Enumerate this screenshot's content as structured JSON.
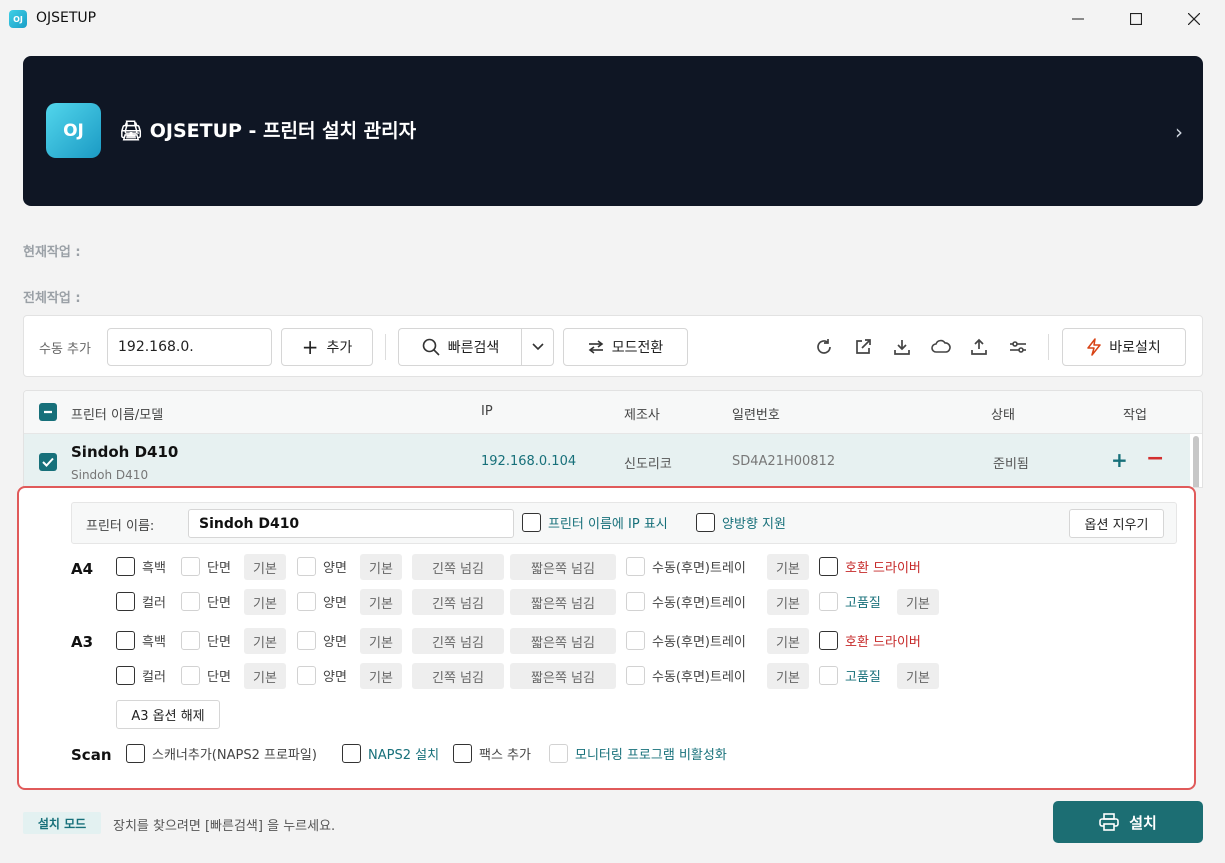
{
  "window": {
    "title": "OJSETUP",
    "app_icon_text": "OJ"
  },
  "banner": {
    "logo_text": "OJ",
    "title": "🖨 OJSETUP - 프린터 설치 관리자"
  },
  "status": {
    "current_label": "현재작업 :",
    "total_label": "전체작업 :"
  },
  "toolbar": {
    "manual_add_label": "수동 추가",
    "ip_value": "192.168.0.",
    "add_label": "추가",
    "quick_search_label": "빠른검색",
    "mode_switch_label": "모드전환",
    "quick_install_label": "바로설치"
  },
  "table": {
    "headers": {
      "name": "프린터 이름/모델",
      "ip": "IP",
      "maker": "제조사",
      "serial": "일련번호",
      "status": "상태",
      "action": "작업"
    },
    "rows": [
      {
        "name": "Sindoh D410",
        "model": "Sindoh D410",
        "ip": "192.168.0.104",
        "maker": "신도리코",
        "serial": "SD4A21H00812",
        "status": "준비됨"
      }
    ]
  },
  "options": {
    "printer_name_label": "프린터 이름:",
    "printer_name_value": "Sindoh D410",
    "show_ip_label": "프린터 이름에 IP 표시",
    "duplex_support_label": "양방향 지원",
    "clear_label": "옵션 지우기",
    "a4_label": "A4",
    "a3_label": "A3",
    "scan_label": "Scan",
    "mono": "흑백",
    "color": "컬러",
    "simplex": "단면",
    "duplex": "양면",
    "default": "기본",
    "long_edge": "긴쪽 넘김",
    "short_edge": "짧은쪽 넘김",
    "manual_tray": "수동(후면)트레이",
    "compat_driver": "호환 드라이버",
    "high_quality": "고품질",
    "a3_release": "A3 옵션 해제",
    "scanner_add": "스캐너추가(NAPS2 프로파일)",
    "naps2_install": "NAPS2 설치",
    "fax_add": "팩스 추가",
    "monitor_disable": "모니터링 프로그램 비활성화"
  },
  "footer": {
    "mode_badge": "설치 모드",
    "hint": "장치를 찾으려면 [빠른검색] 을 누르세요.",
    "install_label": "설치"
  },
  "colors": {
    "accent": "#17707a",
    "banner_bg": "#0f1624",
    "alert": "#c62828",
    "panel_border": "#e05a5a"
  }
}
